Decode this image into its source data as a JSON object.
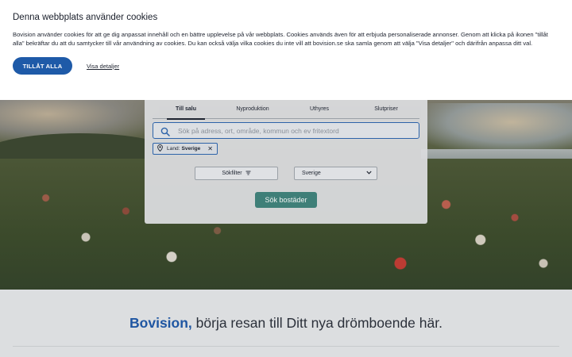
{
  "cookie_banner": {
    "title": "Denna webbplats använder cookies",
    "text": "Bovision använder cookies för att ge dig anpassat innehåll och en bättre upplevelse på vår webbplats. Cookies används även för att erbjuda personaliserade annonser. Genom att klicka på ikonen \"tillåt alla\" bekräftar du att du samtycker till vår användning av cookies. Du kan också välja vilka cookies du inte vill att bovision.se ska samla genom att välja \"Visa detaljer\" och därifrån anpassa ditt val.",
    "accept_label": "TILLÅT ALLA",
    "details_label": "Visa detaljer",
    "accent_color": "#1e5aa8"
  },
  "search": {
    "tabs": [
      "Till salu",
      "Nyproduktion",
      "Uthyres",
      "Slutpriser"
    ],
    "active_tab": "Till salu",
    "placeholder": "Sök på adress, ort, område, kommun och ev fritextord",
    "chip": {
      "label": "Land:",
      "value": "Sverige"
    },
    "filter_label": "Sökfilter",
    "country_selected": "Sverige",
    "submit_label": "Sök bostäder",
    "submit_color": "#3f7f78"
  },
  "tagline": {
    "brand": "Bovision,",
    "text": " börja resan till Ditt nya drömboende här."
  },
  "icons": [
    "search-icon",
    "location-pin-icon",
    "close-icon",
    "filter-icon",
    "chevron-down-icon"
  ]
}
